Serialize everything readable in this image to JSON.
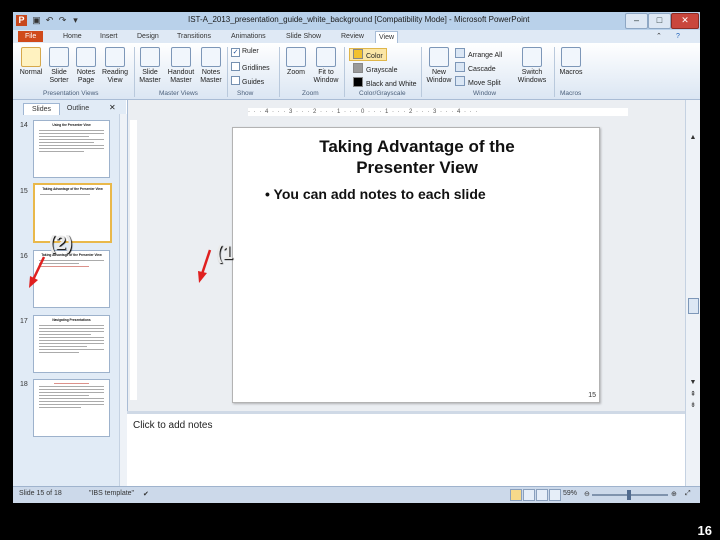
{
  "window": {
    "title": "IST-A_2013_presentation_guide_white_background [Compatibility Mode] - Microsoft PowerPoint",
    "controls": [
      "–",
      "□",
      "✕"
    ],
    "help": "?"
  },
  "ribbon": {
    "tabs": [
      "File",
      "Home",
      "Insert",
      "Design",
      "Transitions",
      "Animations",
      "Slide Show",
      "Review",
      "View"
    ],
    "presentation_views": {
      "group": "Presentation Views",
      "buttons": [
        {
          "label": "Normal",
          "icon": "normal-view-icon"
        },
        {
          "label": "Slide Sorter",
          "icon": "slide-sorter-icon"
        },
        {
          "label": "Notes Page",
          "icon": "notes-page-icon"
        },
        {
          "label": "Reading View",
          "icon": "reading-view-icon"
        }
      ]
    },
    "master_views": {
      "group": "Master Views",
      "buttons": [
        {
          "label": "Slide Master",
          "icon": "slide-master-icon"
        },
        {
          "label": "Handout Master",
          "icon": "handout-master-icon"
        },
        {
          "label": "Notes Master",
          "icon": "notes-master-icon"
        }
      ]
    },
    "show": {
      "group": "Show",
      "options": [
        {
          "label": "Ruler",
          "checked": true
        },
        {
          "label": "Gridlines",
          "checked": false
        },
        {
          "label": "Guides",
          "checked": false
        }
      ]
    },
    "zoom": {
      "group": "Zoom",
      "buttons": [
        {
          "label": "Zoom",
          "icon": "zoom-icon"
        },
        {
          "label": "Fit to Window",
          "icon": "fit-to-window-icon"
        }
      ]
    },
    "color": {
      "group": "Color/Grayscale",
      "options": [
        {
          "label": "Color",
          "swatch": "#f2c12e"
        },
        {
          "label": "Grayscale",
          "swatch": "#9a9a9a"
        },
        {
          "label": "Black and White",
          "swatch": "#000000"
        }
      ]
    },
    "window": {
      "group": "Window",
      "new_window": "New Window",
      "small": [
        "Arrange All",
        "Cascade",
        "Move Split"
      ],
      "switch_windows": "Switch Windows"
    },
    "macros": {
      "group": "Macros",
      "label": "Macros"
    }
  },
  "slides_pane": {
    "tabs": [
      "Slides",
      "Outline"
    ],
    "thumbnails": [
      {
        "number": "14",
        "title": "Using the Presenter View",
        "selected": false
      },
      {
        "number": "15",
        "title": "Taking Advantage of the Presenter View",
        "selected": true
      },
      {
        "number": "16",
        "title": "Taking Advantage of the Presenter View",
        "selected": false
      },
      {
        "number": "17",
        "title": "Navigating Presentations",
        "selected": false
      },
      {
        "number": "18",
        "title": "",
        "selected": false
      }
    ]
  },
  "ruler": "· · · 4 · · · 3 · · · 2 · · · 1 · · · 0 · · · 1 · · · 2 · · · 3 · · · 4 · · ·",
  "slide": {
    "title_line1": "Taking Advantage of the",
    "title_line2": "Presenter View",
    "bullet": "• You can add notes to each slide",
    "number": "15"
  },
  "notes": {
    "placeholder": "Click to add notes"
  },
  "status": {
    "slide_indicator": "Slide 15 of 18",
    "theme": "\"IBS template\"",
    "zoom": "59%"
  },
  "annotations": {
    "label_1": "(1",
    "label_2": "(2)",
    "arrow_color": "#e02020"
  },
  "page_number": "16"
}
